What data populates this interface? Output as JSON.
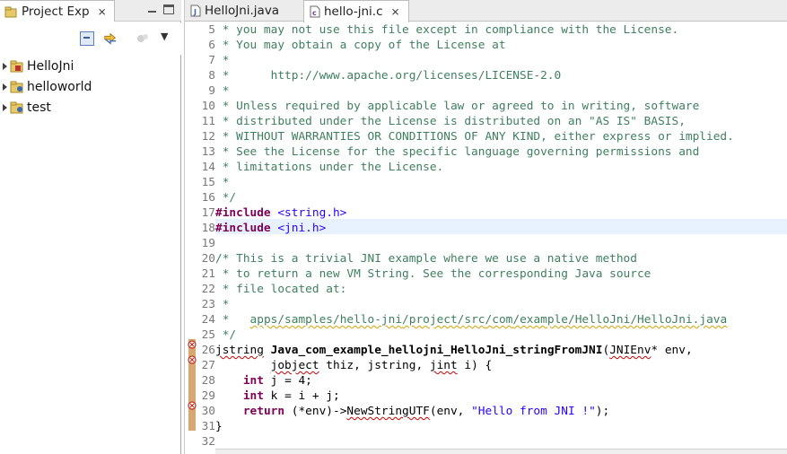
{
  "left_panel": {
    "tab_label": "Project Exp",
    "tree": [
      {
        "label": "HelloJni"
      },
      {
        "label": "helloworld"
      },
      {
        "label": "test"
      }
    ]
  },
  "editor": {
    "tabs": [
      {
        "label": "HelloJni.java",
        "active": false
      },
      {
        "label": "hello-jni.c",
        "active": true
      }
    ],
    "line_numbers": [
      "5",
      "6",
      "7",
      "8",
      "9",
      "10",
      "11",
      "12",
      "13",
      "14",
      "15",
      "16",
      "17",
      "18",
      "19",
      "20",
      "21",
      "22",
      "23",
      "24",
      "25",
      "26",
      "27",
      "28",
      "29",
      "30",
      "31",
      "32"
    ],
    "code": {
      "l5": " * you may not use this file except in compliance with the License.",
      "l6": " * You may obtain a copy of the License at",
      "l7": " *",
      "l8": " *      http://www.apache.org/licenses/LICENSE-2.0",
      "l9": " *",
      "l10": " * Unless required by applicable law or agreed to in writing, software",
      "l11": " * distributed under the License is distributed on an \"AS IS\" BASIS,",
      "l12": " * WITHOUT WARRANTIES OR CONDITIONS OF ANY KIND, either express or implied.",
      "l13": " * See the License for the specific language governing permissions and",
      "l14": " * limitations under the License.",
      "l15": " *",
      "l16": " */",
      "l17_dir": "#include",
      "l17_inc": " <string.h>",
      "l18_dir": "#include",
      "l18_inc": " <jni.h>",
      "l19": "",
      "l20": "/* This is a trivial JNI example where we use a native method",
      "l21": " * to return a new VM String. See the corresponding Java source",
      "l22": " * file located at:",
      "l23": " *",
      "l24_a": " *   ",
      "l24_b": "apps/samples/hello-",
      "l24_c": "jni",
      "l24_d": "/project/",
      "l24_e": "src",
      "l24_f": "/",
      "l24_g": "com",
      "l24_h": "/example/HelloJni/HelloJni.java",
      "l25": " */",
      "l26_a": "jstring",
      "l26_b": " ",
      "l26_c": "Java_com_example_hellojni_HelloJni_stringFromJNI",
      "l26_d": "(",
      "l26_e": "JNIEnv",
      "l26_f": "* env,",
      "l27_a": "        ",
      "l27_b": "jobject",
      "l27_c": " thiz, jstring, ",
      "l27_d": "jint",
      "l27_e": " i) {",
      "l28_a": "    ",
      "l28_b": "int",
      "l28_c": " j = 4;",
      "l29_a": "    ",
      "l29_b": "int",
      "l29_c": " k = i + j;",
      "l30_a": "    ",
      "l30_b": "return",
      "l30_c": " (*env)->",
      "l30_d": "NewStringUTF",
      "l30_e": "(env, ",
      "l30_f": "\"Hello from JNI !\"",
      "l30_g": ");",
      "l31": "}",
      "l32": ""
    }
  },
  "colors": {
    "comment": "#3f7f5f",
    "keyword": "#7f0055",
    "string": "#2a00ff",
    "current_line": "#e8f2fe",
    "annotation_ruler": "#d8a873",
    "error_squiggle": "#d00000"
  }
}
